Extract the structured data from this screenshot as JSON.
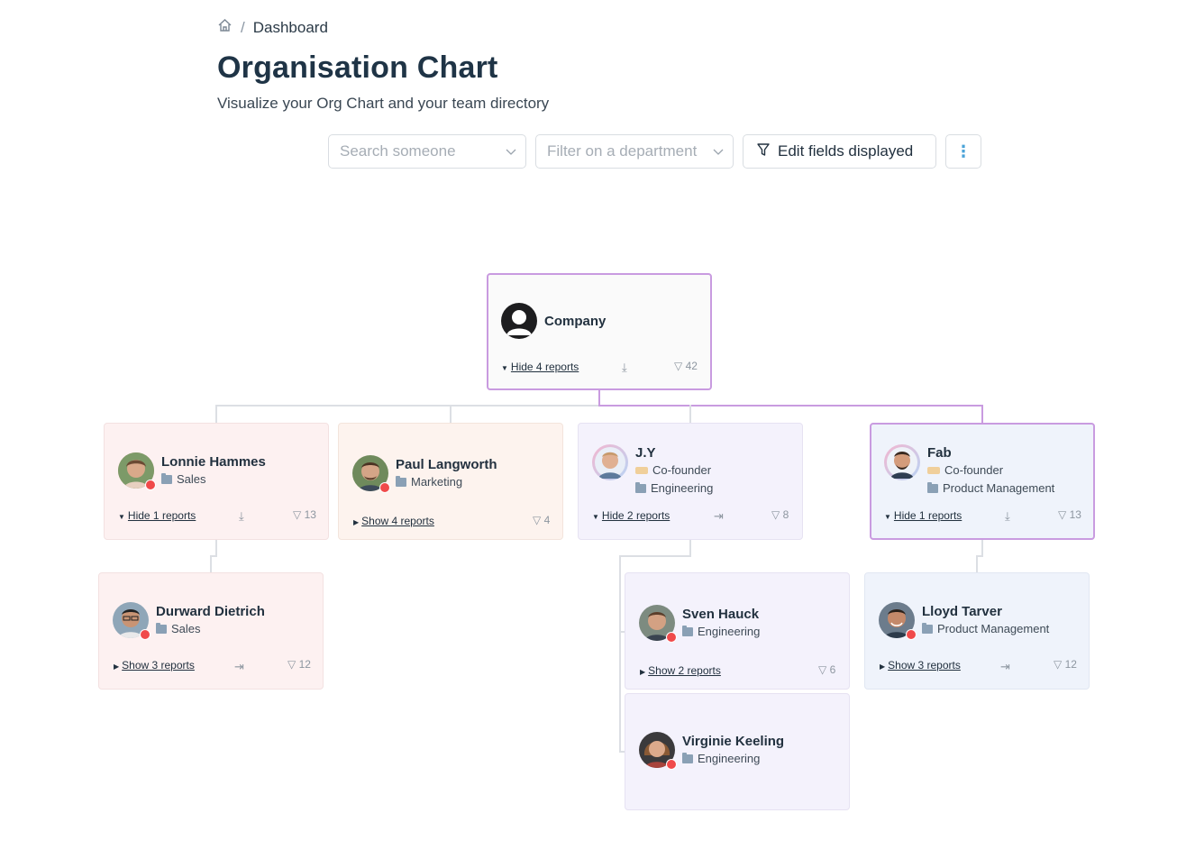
{
  "breadcrumb": {
    "home_icon": "home-icon",
    "separator": "/",
    "current": "Dashboard"
  },
  "header": {
    "title": "Organisation Chart",
    "subtitle": "Visualize your Org Chart and your team directory"
  },
  "toolbar": {
    "search_placeholder": "Search someone",
    "department_placeholder": "Filter on a department",
    "edit_fields_label": "Edit fields displayed",
    "more_icon": "kebab-icon"
  },
  "colors": {
    "accent": "#c99be0",
    "sales": "#fdf1f1",
    "marketing": "#fdf3ee",
    "engineering": "#f4f2fc",
    "product": "#eff3fb",
    "status": "#f04a4a"
  },
  "org": {
    "company": {
      "name": "Company",
      "reports_label": "Hide 4 reports",
      "count": "42"
    },
    "lonnie": {
      "name": "Lonnie Hammes",
      "department": "Sales",
      "reports_label": "Hide 1 reports",
      "count": "13"
    },
    "paul": {
      "name": "Paul Langworth",
      "department": "Marketing",
      "reports_label": "Show 4 reports",
      "count": "4"
    },
    "jy": {
      "name": "J.Y",
      "title": "Co-founder",
      "department": "Engineering",
      "reports_label": "Hide 2 reports",
      "count": "8"
    },
    "fab": {
      "name": "Fab",
      "title": "Co-founder",
      "department": "Product Management",
      "reports_label": "Hide 1 reports",
      "count": "13"
    },
    "durward": {
      "name": "Durward Dietrich",
      "department": "Sales",
      "reports_label": "Show 3 reports",
      "count": "12"
    },
    "sven": {
      "name": "Sven Hauck",
      "department": "Engineering",
      "reports_label": "Show 2 reports",
      "count": "6"
    },
    "lloyd": {
      "name": "Lloyd Tarver",
      "department": "Product Management",
      "reports_label": "Show 3 reports",
      "count": "12"
    },
    "virginie": {
      "name": "Virginie Keeling",
      "department": "Engineering"
    }
  }
}
